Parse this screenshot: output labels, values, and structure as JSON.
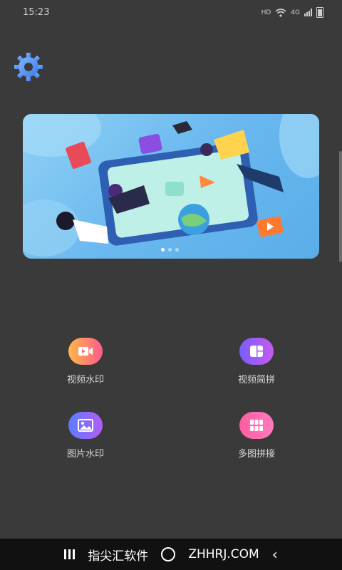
{
  "status_bar": {
    "time": "15:23",
    "network_label": "HD",
    "cell_label": "4G"
  },
  "toolbar": {
    "settings_icon": "gear-icon",
    "accent_color": "#4d8ff0"
  },
  "banner": {
    "page_indicator_count": 3,
    "active_page": 1
  },
  "features": [
    {
      "label": "视频水印",
      "icon": "video-icon"
    },
    {
      "label": "视频简拼",
      "icon": "collage-icon"
    },
    {
      "label": "图片水印",
      "icon": "image-icon"
    },
    {
      "label": "多图拼接",
      "icon": "grid-icon"
    }
  ],
  "watermark": {
    "left_text": "指尖汇软件",
    "right_text": "ZHHRJ.COM"
  }
}
